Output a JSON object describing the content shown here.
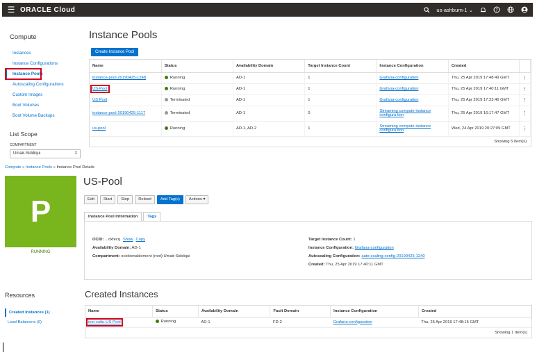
{
  "topbar": {
    "menu_icon": "hamburger-icon",
    "logo": "ORACLE Cloud",
    "region": "us-ashburn-1",
    "icons": [
      "search-icon",
      "bell-icon",
      "help-icon",
      "globe-icon",
      "user-icon"
    ]
  },
  "sidebar": {
    "title": "Compute",
    "items": [
      {
        "label": "Instances"
      },
      {
        "label": "Instance Configurations"
      },
      {
        "label": "Instance Pools"
      },
      {
        "label": "Autoscaling Configurations"
      },
      {
        "label": "Custom Images"
      },
      {
        "label": "Boot Volumes"
      },
      {
        "label": "Boot Volume Backups"
      }
    ],
    "list_scope": "List Scope",
    "compartment_label": "COMPARTMENT",
    "compartment_value": "Umair-Siddiqui"
  },
  "pools": {
    "title": "Instance Pools",
    "create_button": "Create Instance Pool",
    "columns": [
      "Name",
      "Status",
      "Availability Domain",
      "Target Instance Count",
      "Instance Configuration",
      "Created"
    ],
    "rows": [
      {
        "name": "instance-pool-20190425-1248",
        "status": "Running",
        "ad": "AD-1",
        "count": "1",
        "config": "Grafana-configuration",
        "created": "Thu, 25 Apr 2019 17:48:49 GMT"
      },
      {
        "name": "US-Pool",
        "status": "Running",
        "ad": "AD-1",
        "count": "1",
        "config": "Grafana-configuration",
        "created": "Thu, 25 Apr 2019 17:40:11 GMT"
      },
      {
        "name": "US Pool",
        "status": "Terminated",
        "ad": "AD-1",
        "count": "1",
        "config": "Grafana-configuration",
        "created": "Thu, 25 Apr 2019 17:23:46 GMT"
      },
      {
        "name": "instance-pool-20190425-1117",
        "status": "Terminated",
        "ad": "AD-1",
        "count": "0",
        "config": "Streaming compute-instance configura tion",
        "created": "Thu, 25 Apr 2019 16:17:47 GMT"
      },
      {
        "name": "us-pool",
        "status": "Running",
        "ad": "AD-1, AD-2",
        "count": "1",
        "config": "Streaming compute-instance configura tion",
        "created": "Wed, 24 Apr 2019 20:27:09 GMT"
      }
    ],
    "showing": "Showing 5 Item(s)"
  },
  "breadcrumb": {
    "a": "Compute",
    "sep": " » ",
    "b": "Instance Pools",
    "c": "Instance Pool Details"
  },
  "detail": {
    "letter": "P",
    "status": "RUNNING",
    "title": "US-Pool",
    "buttons": {
      "edit": "Edit",
      "start": "Start",
      "stop": "Stop",
      "reboot": "Reboot",
      "tags": "Add Tag(s)",
      "actions": "Actions"
    },
    "tabs": {
      "info": "Instance Pool Information",
      "tags": "Tags"
    },
    "ocid_label": "OCID:",
    "ocid_value": "...dxfecq",
    "show": "Show",
    "copy": "Copy",
    "ad_label": "Availability Domain:",
    "ad_value": "AD-1",
    "compartment_label": "Compartment:",
    "compartment_value": "ociobenablement (root):Umair-Siddiqui",
    "target_label": "Target Instance Count:",
    "target_value": "1",
    "config_label": "Instance Configuration:",
    "config_value": "Grafana-configuration",
    "autoscale_label": "Autoscaling Configuration:",
    "autoscale_value": "auto-scaling-config-20190425-1240",
    "created_label": "Created:",
    "created_value": "Thu, 25 Apr 2019 17:40:11 GMT"
  },
  "resources": {
    "title": "Resources",
    "created_instances": "Created Instances (1)",
    "load_balancers": "Load Balancers (0)"
  },
  "instances": {
    "title": "Created Instances",
    "columns": [
      "Name",
      "Status",
      "Availability Domain",
      "Fault Domain",
      "Instance Configuration",
      "Created"
    ],
    "rows": [
      {
        "name": "inst-zotlu-US-Pool",
        "status": "Running",
        "ad": "AD-1",
        "fd": "FD-2",
        "config": "Grafana-configuration",
        "created": "Thu, 25 Apr 2019 17:48:15 GMT"
      }
    ],
    "showing": "Showing 1 Item(s)"
  },
  "colors": {
    "accent": "#0572ce",
    "topbar": "#312d2a",
    "running": "#3f7e00",
    "tile": "#79b51c",
    "highlight": "#d0021b"
  }
}
